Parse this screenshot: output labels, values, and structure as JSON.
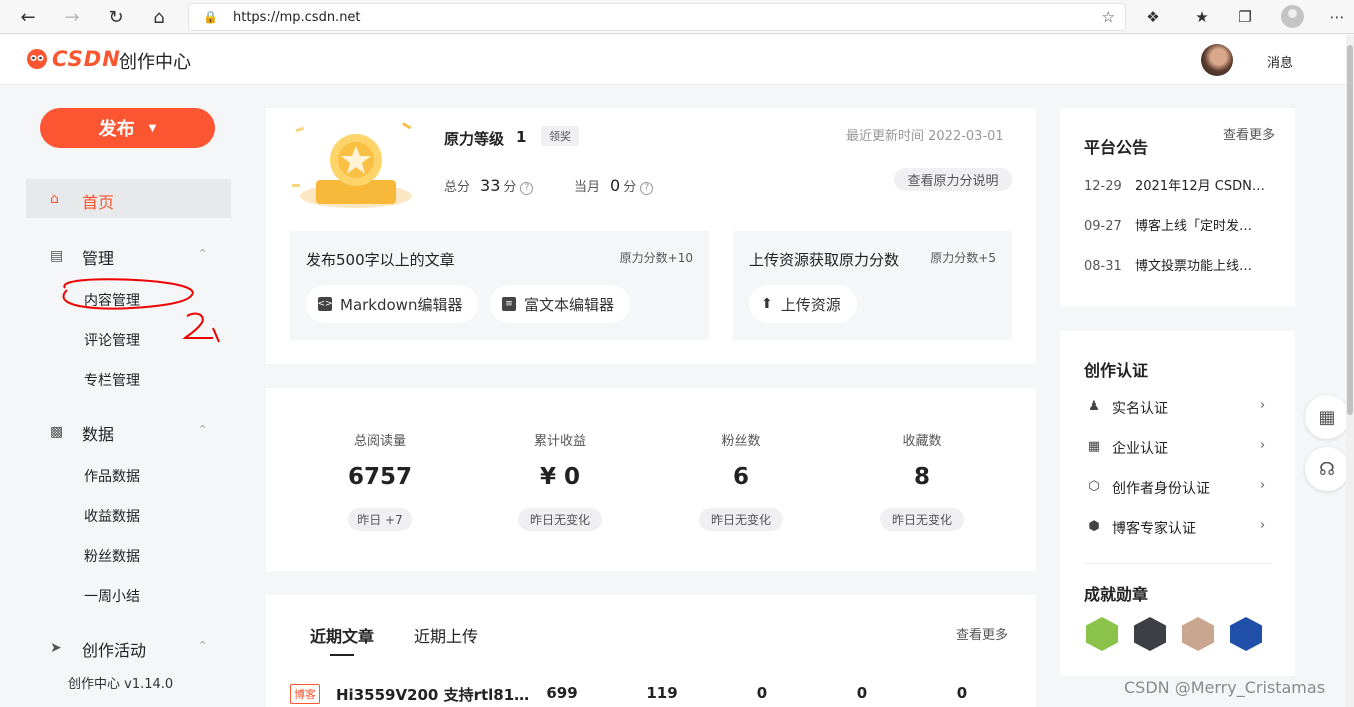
{
  "browser": {
    "url": "https://mp.csdn.net"
  },
  "header": {
    "logo_text": "CSDN",
    "title": "创作中心",
    "messages": "消息"
  },
  "sidebar": {
    "publish": "发布",
    "home": "首页",
    "groups": [
      {
        "label": "管理",
        "items": [
          "内容管理",
          "评论管理",
          "专栏管理"
        ]
      },
      {
        "label": "数据",
        "items": [
          "作品数据",
          "收益数据",
          "粉丝数据",
          "一周小结"
        ]
      },
      {
        "label": "创作活动",
        "items": []
      }
    ],
    "version": "创作中心 v1.14.0"
  },
  "level": {
    "title_a": "原力等级",
    "level": "1",
    "claim": "领奖",
    "updated": "最近更新时间 2022-03-01",
    "total_label": "总分",
    "total_value": "33",
    "month_label": "当月",
    "month_value": "0",
    "unit": "分",
    "explain": "查看原力分说明",
    "tasks": [
      {
        "title": "发布500字以上的文章",
        "bonus": "原力分数+10",
        "actions": [
          "Markdown编辑器",
          "富文本编辑器"
        ]
      },
      {
        "title": "上传资源获取原力分数",
        "bonus": "原力分数+5",
        "actions": [
          "上传资源"
        ]
      }
    ]
  },
  "stats": [
    {
      "label": "总阅读量",
      "value": "6757",
      "change": "昨日 +7"
    },
    {
      "label": "累计收益",
      "value": "¥ 0",
      "change": "昨日无变化"
    },
    {
      "label": "粉丝数",
      "value": "6",
      "change": "昨日无变化"
    },
    {
      "label": "收藏数",
      "value": "8",
      "change": "昨日无变化"
    }
  ],
  "recent": {
    "tabs": [
      "近期文章",
      "近期上传"
    ],
    "see_more": "查看更多",
    "article": {
      "tag": "博客",
      "title": "Hi3559V200 支持rtl81…",
      "nums": [
        "699",
        "119",
        "0",
        "0",
        "0"
      ]
    }
  },
  "announcements": {
    "title": "平台公告",
    "see_more": "查看更多",
    "items": [
      {
        "date": "12-29",
        "text": "2021年12月 CSDN…"
      },
      {
        "date": "09-27",
        "text": "博客上线「定时发…"
      },
      {
        "date": "08-31",
        "text": "博文投票功能上线…"
      }
    ]
  },
  "certification": {
    "title": "创作认证",
    "items": [
      "实名认证",
      "企业认证",
      "创作者身份认证",
      "博客专家认证"
    ],
    "achievements_title": "成就勋章",
    "badge_colors": [
      "#8bc34a",
      "#3e3e46",
      "#c9a690",
      "#1f4fa8"
    ]
  },
  "watermark": "CSDN @Merry_Cristamas"
}
